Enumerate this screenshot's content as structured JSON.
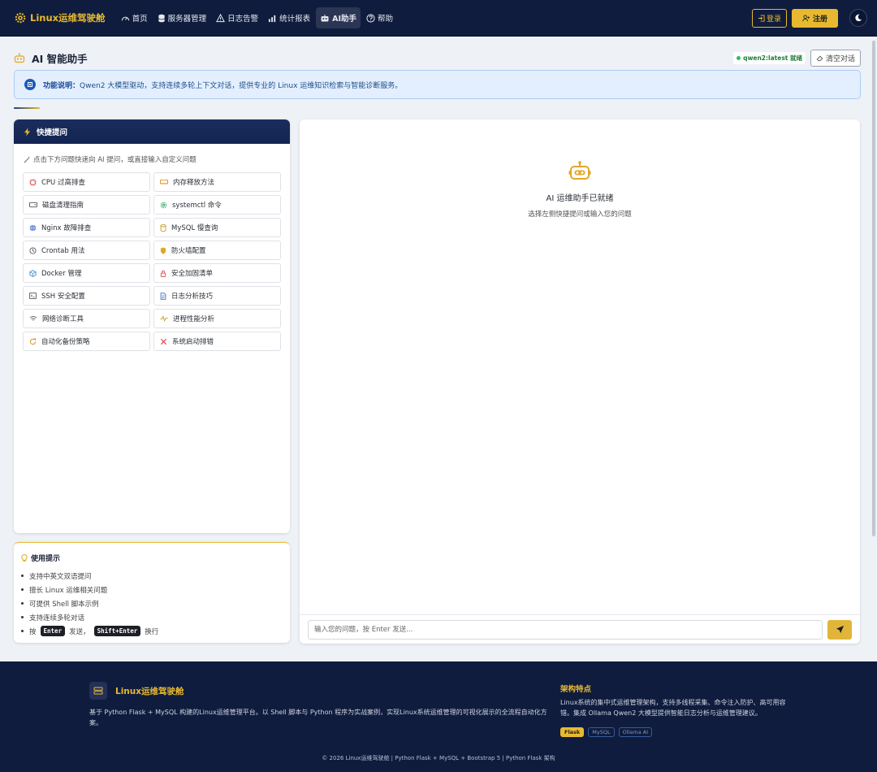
{
  "navbar": {
    "brand": "Linux运维驾驶舱",
    "items": [
      {
        "label": "首页",
        "icon": "dashboard-icon"
      },
      {
        "label": "服务器管理",
        "icon": "database-icon"
      },
      {
        "label": "日志告警",
        "icon": "warning-icon"
      },
      {
        "label": "统计报表",
        "icon": "bar-chart-icon"
      },
      {
        "label": "AI助手",
        "icon": "robot-icon",
        "active": true
      },
      {
        "label": "帮助",
        "icon": "help-icon"
      }
    ],
    "login": "登录",
    "register": "注册"
  },
  "page": {
    "title": "AI 智能助手",
    "model_status": "qwen2:latest 就绪",
    "clear_button": "清空对话"
  },
  "banner": {
    "label": "功能说明：",
    "text": "Qwen2 大模型驱动，支持连续多轮上下文对话，提供专业的 Linux 运维知识检索与智能诊断服务。"
  },
  "quick": {
    "title": "快捷提问",
    "hint": "点击下方问题快速向 AI 提问，或直接输入自定义问题",
    "items": [
      {
        "label": "CPU 过高排查",
        "icon": "cpu-icon"
      },
      {
        "label": "内存释放方法",
        "icon": "memory-icon"
      },
      {
        "label": "磁盘清理指南",
        "icon": "disk-icon"
      },
      {
        "label": "systemctl 命令",
        "icon": "gear-icon"
      },
      {
        "label": "Nginx 故障排查",
        "icon": "globe-icon"
      },
      {
        "label": "MySQL 慢查询",
        "icon": "database-icon"
      },
      {
        "label": "Crontab 用法",
        "icon": "clock-icon"
      },
      {
        "label": "防火墙配置",
        "icon": "shield-icon"
      },
      {
        "label": "Docker 管理",
        "icon": "box-icon"
      },
      {
        "label": "安全加固清单",
        "icon": "lock-icon"
      },
      {
        "label": "SSH 安全配置",
        "icon": "terminal-icon"
      },
      {
        "label": "日志分析技巧",
        "icon": "document-icon"
      },
      {
        "label": "网络诊断工具",
        "icon": "wifi-icon"
      },
      {
        "label": "进程性能分析",
        "icon": "activity-icon"
      },
      {
        "label": "自动化备份策略",
        "icon": "refresh-icon"
      },
      {
        "label": "系统启动排错",
        "icon": "tools-icon"
      }
    ]
  },
  "tips": {
    "title": "使用提示",
    "items": [
      "支持中英文双语提问",
      "擅长 Linux 运维相关问题",
      "可提供 Shell 脚本示例",
      "支持连续多轮对话"
    ],
    "last": {
      "prefix": "按",
      "key1": "Enter",
      "mid": "发送，",
      "key2": "Shift+Enter",
      "suffix": "换行"
    }
  },
  "chat": {
    "empty_title": "AI 运维助手已就绪",
    "empty_sub": "选择左侧快捷提问或输入您的问题",
    "input_placeholder": "输入您的问题，按 Enter 发送..."
  },
  "footer": {
    "brand": "Linux运维驾驶舱",
    "desc": "基于 Python Flask + MySQL 构建的Linux运维管理平台。以 Shell 脚本与 Python 程序为实战案例，实现Linux系统运维管理的可视化展示的全流程自动化方案。",
    "arch_title": "架构特点",
    "arch_desc": "Linux系统的集中式运维管理架构，支持多线程采集、命令注入防护、高可用容错。集成 Ollama Qwen2 大模型提供智能日志分析与运维管理建议。",
    "tags": [
      "Flask",
      "MySQL",
      "Ollama AI"
    ],
    "copyright": "© 2026 Linux运维驾驶舱 | Python Flask + MySQL + Bootstrap 5 | Python Flask 架构"
  },
  "colors": {
    "navy": "#0f1c3d",
    "accent": "#e8b930",
    "info": "#1b5bb8"
  }
}
